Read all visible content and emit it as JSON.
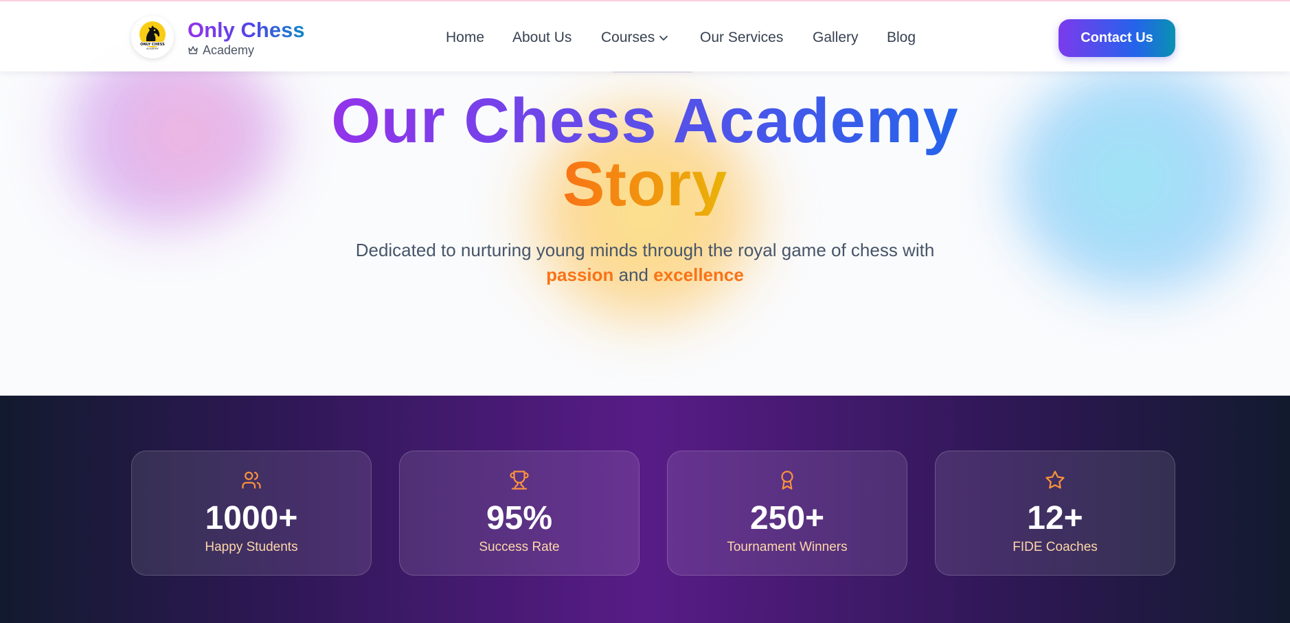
{
  "colors": {
    "brand_gradient": [
      "#9333ea",
      "#2563eb"
    ],
    "accent_orange": "#f97316",
    "stats_bg": "#581c87",
    "stat_label": "#fed7aa"
  },
  "header": {
    "logo": {
      "icon": "chess-knight-logo",
      "text": "ONLY CHESS",
      "subtext": "ACADEMY"
    },
    "brand_name": "Only Chess",
    "brand_sub": "Academy",
    "brand_sub_icon": "crown-icon",
    "nav": {
      "home": "Home",
      "about": "About Us",
      "courses": "Courses",
      "services": "Our Services",
      "gallery": "Gallery",
      "blog": "Blog"
    },
    "contact_label": "Contact Us"
  },
  "hero": {
    "title_line1": "Our Chess Academy",
    "title_line2": "Story",
    "subtitle": "Dedicated to nurturing young minds through the royal game of chess with",
    "highlight1": "passion",
    "connector": "and",
    "highlight2": "excellence"
  },
  "stats": [
    {
      "icon": "users-icon",
      "value": "1000+",
      "label": "Happy Students"
    },
    {
      "icon": "trophy-icon",
      "value": "95%",
      "label": "Success Rate"
    },
    {
      "icon": "award-icon",
      "value": "250+",
      "label": "Tournament Winners"
    },
    {
      "icon": "star-icon",
      "value": "12+",
      "label": "FIDE Coaches"
    }
  ]
}
